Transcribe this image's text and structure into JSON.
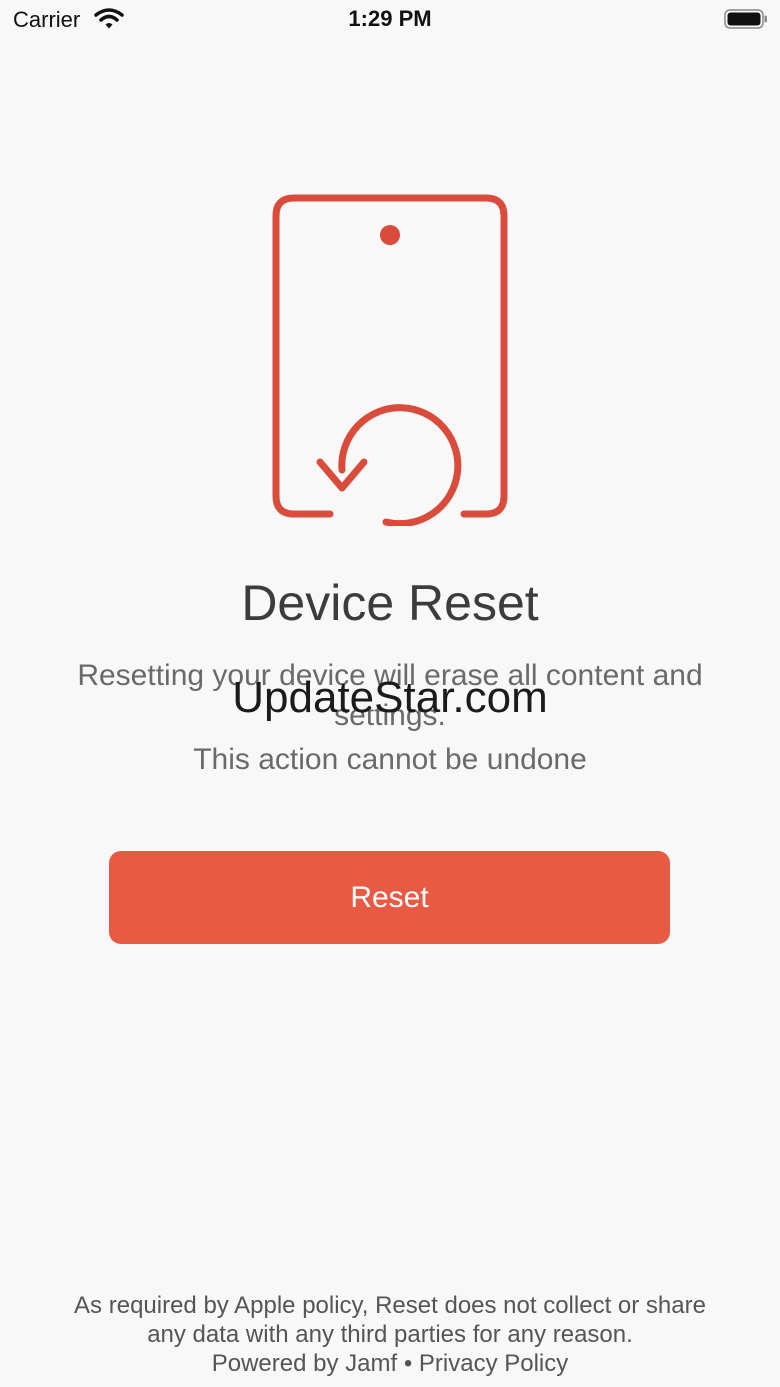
{
  "status_bar": {
    "carrier": "Carrier",
    "time": "1:29 PM",
    "wifi_icon": "wifi-icon",
    "battery_icon": "battery-icon"
  },
  "hero": {
    "icon": "device-reset-icon",
    "accent_color": "#d94b3a"
  },
  "content": {
    "title": "Device Reset",
    "description": "Resetting your device will erase all content and settings.",
    "warning": "This action cannot be undone"
  },
  "watermark": "UpdateStar.com",
  "actions": {
    "reset_label": "Reset",
    "button_color": "#e85a43"
  },
  "footer": {
    "policy_line_1": "As required by Apple policy, Reset does not collect or share",
    "policy_line_2": "any data with any third parties for any reason.",
    "powered_by": "Powered by Jamf",
    "separator": "•",
    "privacy_link": "Privacy Policy"
  }
}
